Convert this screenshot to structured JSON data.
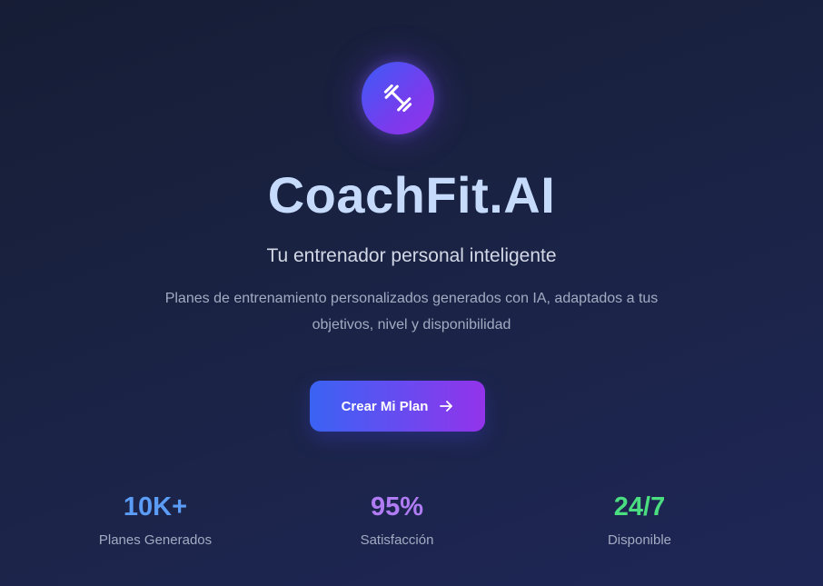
{
  "hero": {
    "logo_icon": "dumbbell-icon",
    "title": "CoachFit.AI",
    "subtitle": "Tu entrenador personal inteligente",
    "description_line1": "Planes de entrenamiento personalizados generados con IA, adaptados a tus",
    "description_line2": "objetivos, nivel y disponibilidad"
  },
  "cta": {
    "label": "Crear Mi Plan",
    "icon": "arrow-right-icon"
  },
  "stats": [
    {
      "value": "10K+",
      "label": "Planes Generados",
      "color": "#5b9cf6"
    },
    {
      "value": "95%",
      "label": "Satisfacción",
      "color": "#b07cf4"
    },
    {
      "value": "24/7",
      "label": "Disponible",
      "color": "#4ade80"
    }
  ],
  "colors": {
    "background": "#1b2447",
    "title": "#c6dbfb",
    "accent_blue": "#3b5bf6",
    "accent_purple": "#9333ea"
  }
}
